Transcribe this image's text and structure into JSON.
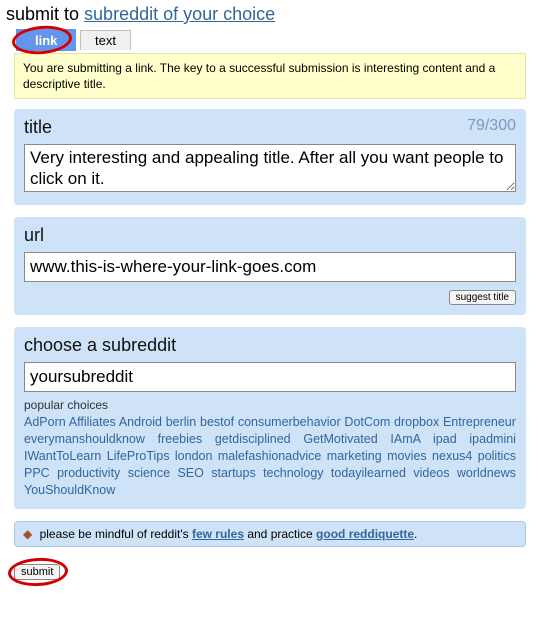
{
  "header": {
    "submit_to": "submit to",
    "subreddit_choice": "subreddit of your choice"
  },
  "tabs": {
    "link": "link",
    "text": "text"
  },
  "infobar": "You are submitting a link. The key to a successful submission is interesting content and a descriptive title.",
  "title_panel": {
    "heading": "title",
    "counter": "79/300",
    "value": "Very interesting and appealing title. After all you want people to click on it."
  },
  "url_panel": {
    "heading": "url",
    "value": "www.this-is-where-your-link-goes.com",
    "suggest_label": "suggest title"
  },
  "subreddit_panel": {
    "heading": "choose a subreddit",
    "value": "yoursubreddit",
    "popular_label": "popular choices",
    "popular": [
      "AdPorn",
      "Affiliates",
      "Android",
      "berlin",
      "bestof",
      "consumerbehavior",
      "DotCom",
      "dropbox",
      "Entrepreneur",
      "everymanshouldknow",
      "freebies",
      "getdisciplined",
      "GetMotivated",
      "IAmA",
      "ipad",
      "ipadmini",
      "IWantToLearn",
      "LifeProTips",
      "london",
      "malefashionadvice",
      "marketing",
      "movies",
      "nexus4",
      "politics",
      "PPC",
      "productivity",
      "science",
      "SEO",
      "startups",
      "technology",
      "todayilearned",
      "videos",
      "worldnews",
      "YouShouldKnow"
    ]
  },
  "rules": {
    "prefix": "please be mindful of reddit's ",
    "few_rules": "few rules",
    "middle": " and practice ",
    "reddiquette": "good reddiquette",
    "suffix": "."
  },
  "submit_label": "submit"
}
